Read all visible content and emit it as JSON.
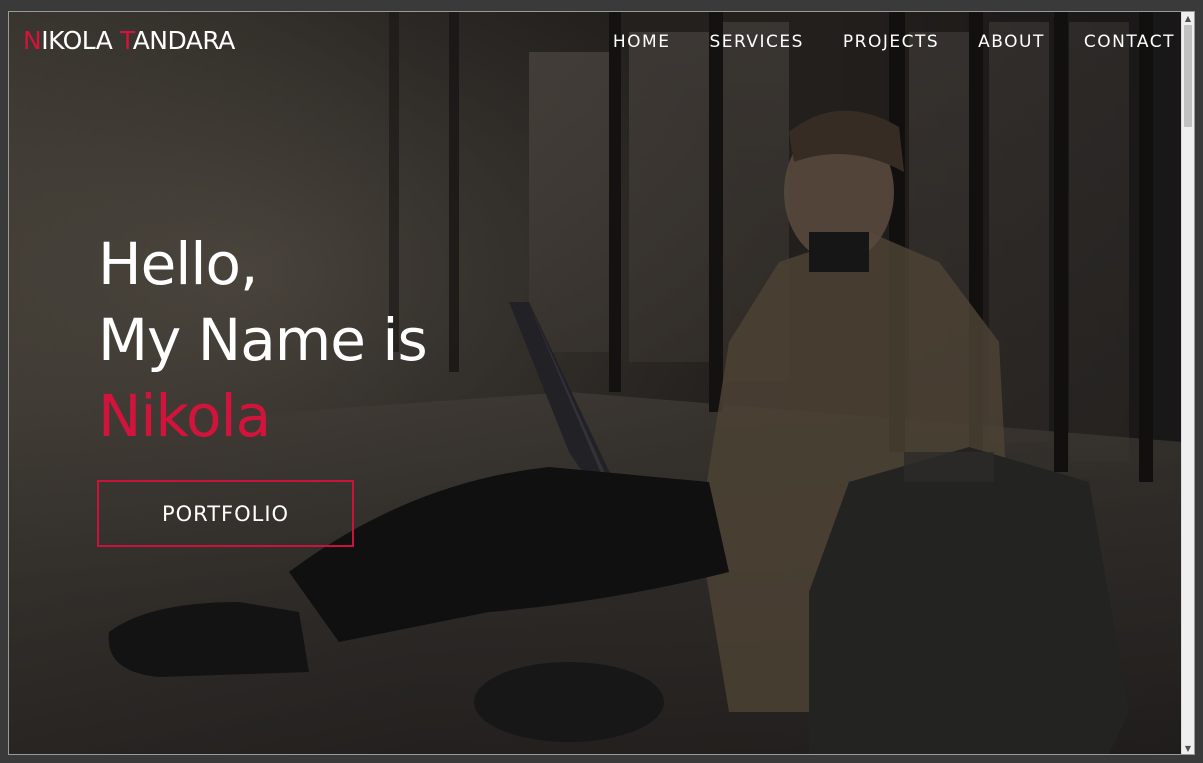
{
  "logo": {
    "first_initial": "N",
    "first_rest": "IKOLA ",
    "last_initial": "T",
    "last_rest": "ANDARA"
  },
  "nav": [
    {
      "label": "HOME"
    },
    {
      "label": "SERVICES"
    },
    {
      "label": "PROJECTS"
    },
    {
      "label": "ABOUT"
    },
    {
      "label": "CONTACT"
    }
  ],
  "hero": {
    "line1": "Hello,",
    "line2": "My Name is",
    "name": "Nikola"
  },
  "cta": {
    "label": "PORTFOLIO"
  },
  "icons": {
    "scroll_up": "triangle-up-icon",
    "scroll_down": "triangle-down-icon"
  },
  "colors": {
    "accent": "#d2143c",
    "text": "#ffffff"
  }
}
